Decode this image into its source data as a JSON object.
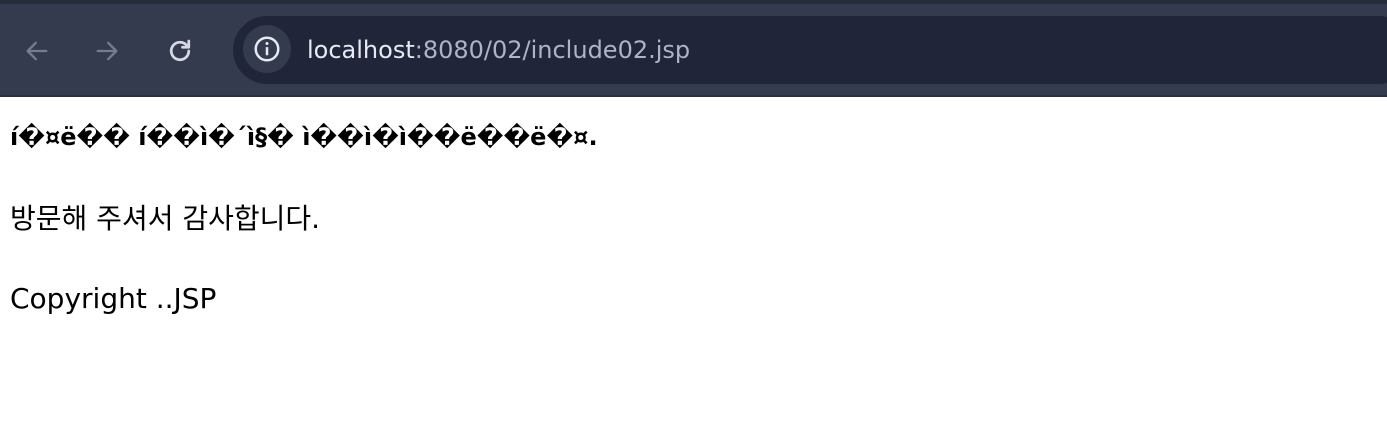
{
  "browser": {
    "url_host": "localhost",
    "url_path": ":8080/02/include02.jsp",
    "icons": [
      "back-arrow-icon",
      "forward-arrow-icon",
      "reload-icon",
      "site-info-icon"
    ],
    "colors": {
      "toolbar": "#353b4f",
      "omnibox": "#21253a",
      "icon": "#9aa0b4"
    }
  },
  "page": {
    "heading": "í�¤ë�� í��ì�´ì§� ì��ì�ì��ë��ë�¤.",
    "message": "방문해 주셔서 감사합니다.",
    "footer": "Copyright ..JSP"
  }
}
